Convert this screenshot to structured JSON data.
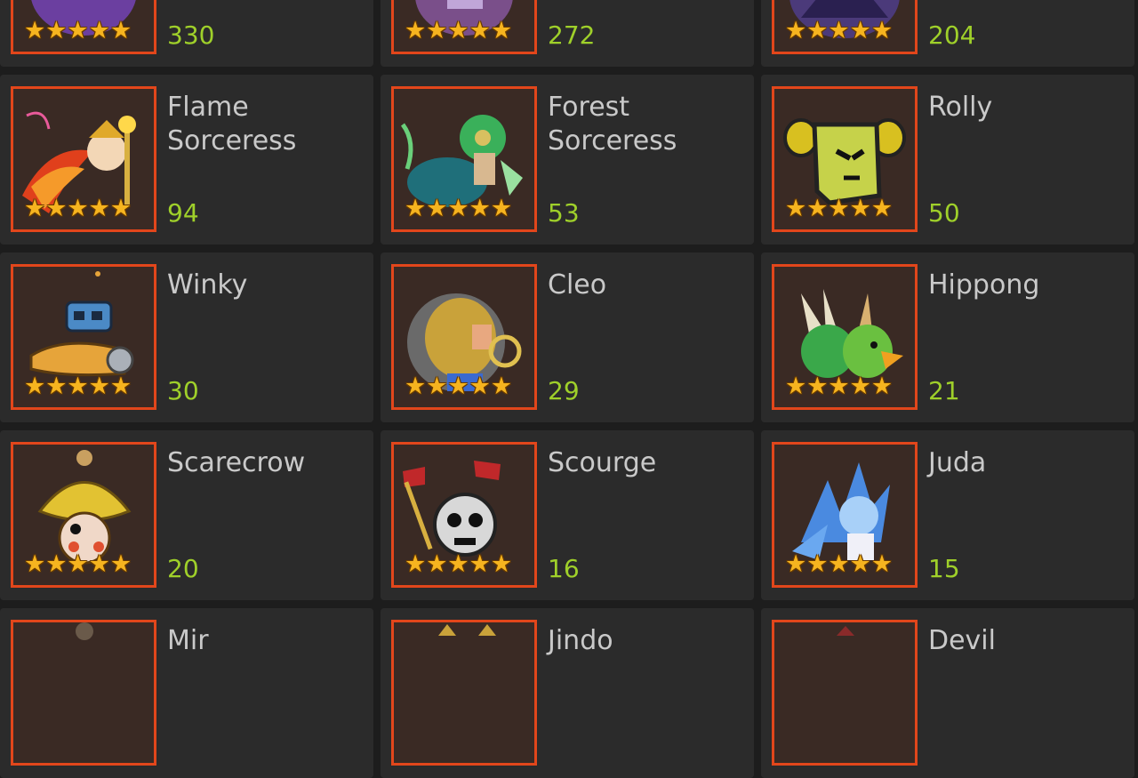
{
  "colors": {
    "background": "#1d1d1d",
    "card": "#2b2b2b",
    "portrait_border": "#e2461b",
    "count_text": "#9fd02a",
    "name_text": "#c9c9c9",
    "star": "#f6b41f"
  },
  "heroes": [
    {
      "name": "",
      "count": "330",
      "stars": 5,
      "icon": "purple-beast-icon",
      "color": "#6b3fa0"
    },
    {
      "name": "",
      "count": "272",
      "stars": 5,
      "icon": "purple-knight-icon",
      "color": "#7a4f8a"
    },
    {
      "name": "",
      "count": "204",
      "stars": 5,
      "icon": "dark-dragon-icon",
      "color": "#4b3a7a"
    },
    {
      "name": "Flame Sorceress",
      "count": "94",
      "stars": 5,
      "icon": "flame-sorceress-icon",
      "color": "#e0401c"
    },
    {
      "name": "Forest Sorceress",
      "count": "53",
      "stars": 5,
      "icon": "forest-sorceress-icon",
      "color": "#2e9a4a"
    },
    {
      "name": "Rolly",
      "count": "50",
      "stars": 5,
      "icon": "rolly-scroll-icon",
      "color": "#c6d24a"
    },
    {
      "name": "Winky",
      "count": "30",
      "stars": 5,
      "icon": "winky-machine-icon",
      "color": "#4b8ac6"
    },
    {
      "name": "Cleo",
      "count": "29",
      "stars": 5,
      "icon": "cleo-icon",
      "color": "#c9a23a"
    },
    {
      "name": "Hippong",
      "count": "21",
      "stars": 5,
      "icon": "hippong-bird-icon",
      "color": "#3aa84a"
    },
    {
      "name": "Scarecrow",
      "count": "20",
      "stars": 5,
      "icon": "scarecrow-icon",
      "color": "#e2c232"
    },
    {
      "name": "Scourge",
      "count": "16",
      "stars": 5,
      "icon": "scourge-skull-icon",
      "color": "#d8d8d8"
    },
    {
      "name": "Juda",
      "count": "15",
      "stars": 5,
      "icon": "juda-ice-icon",
      "color": "#4a8ae0"
    },
    {
      "name": "Mir",
      "count": "",
      "stars": 0,
      "icon": "mir-icon",
      "color": "#6a5a4a"
    },
    {
      "name": "Jindo",
      "count": "",
      "stars": 0,
      "icon": "jindo-icon",
      "color": "#c9a23a"
    },
    {
      "name": "Devil",
      "count": "",
      "stars": 0,
      "icon": "devil-icon",
      "color": "#8a2a2a"
    }
  ]
}
